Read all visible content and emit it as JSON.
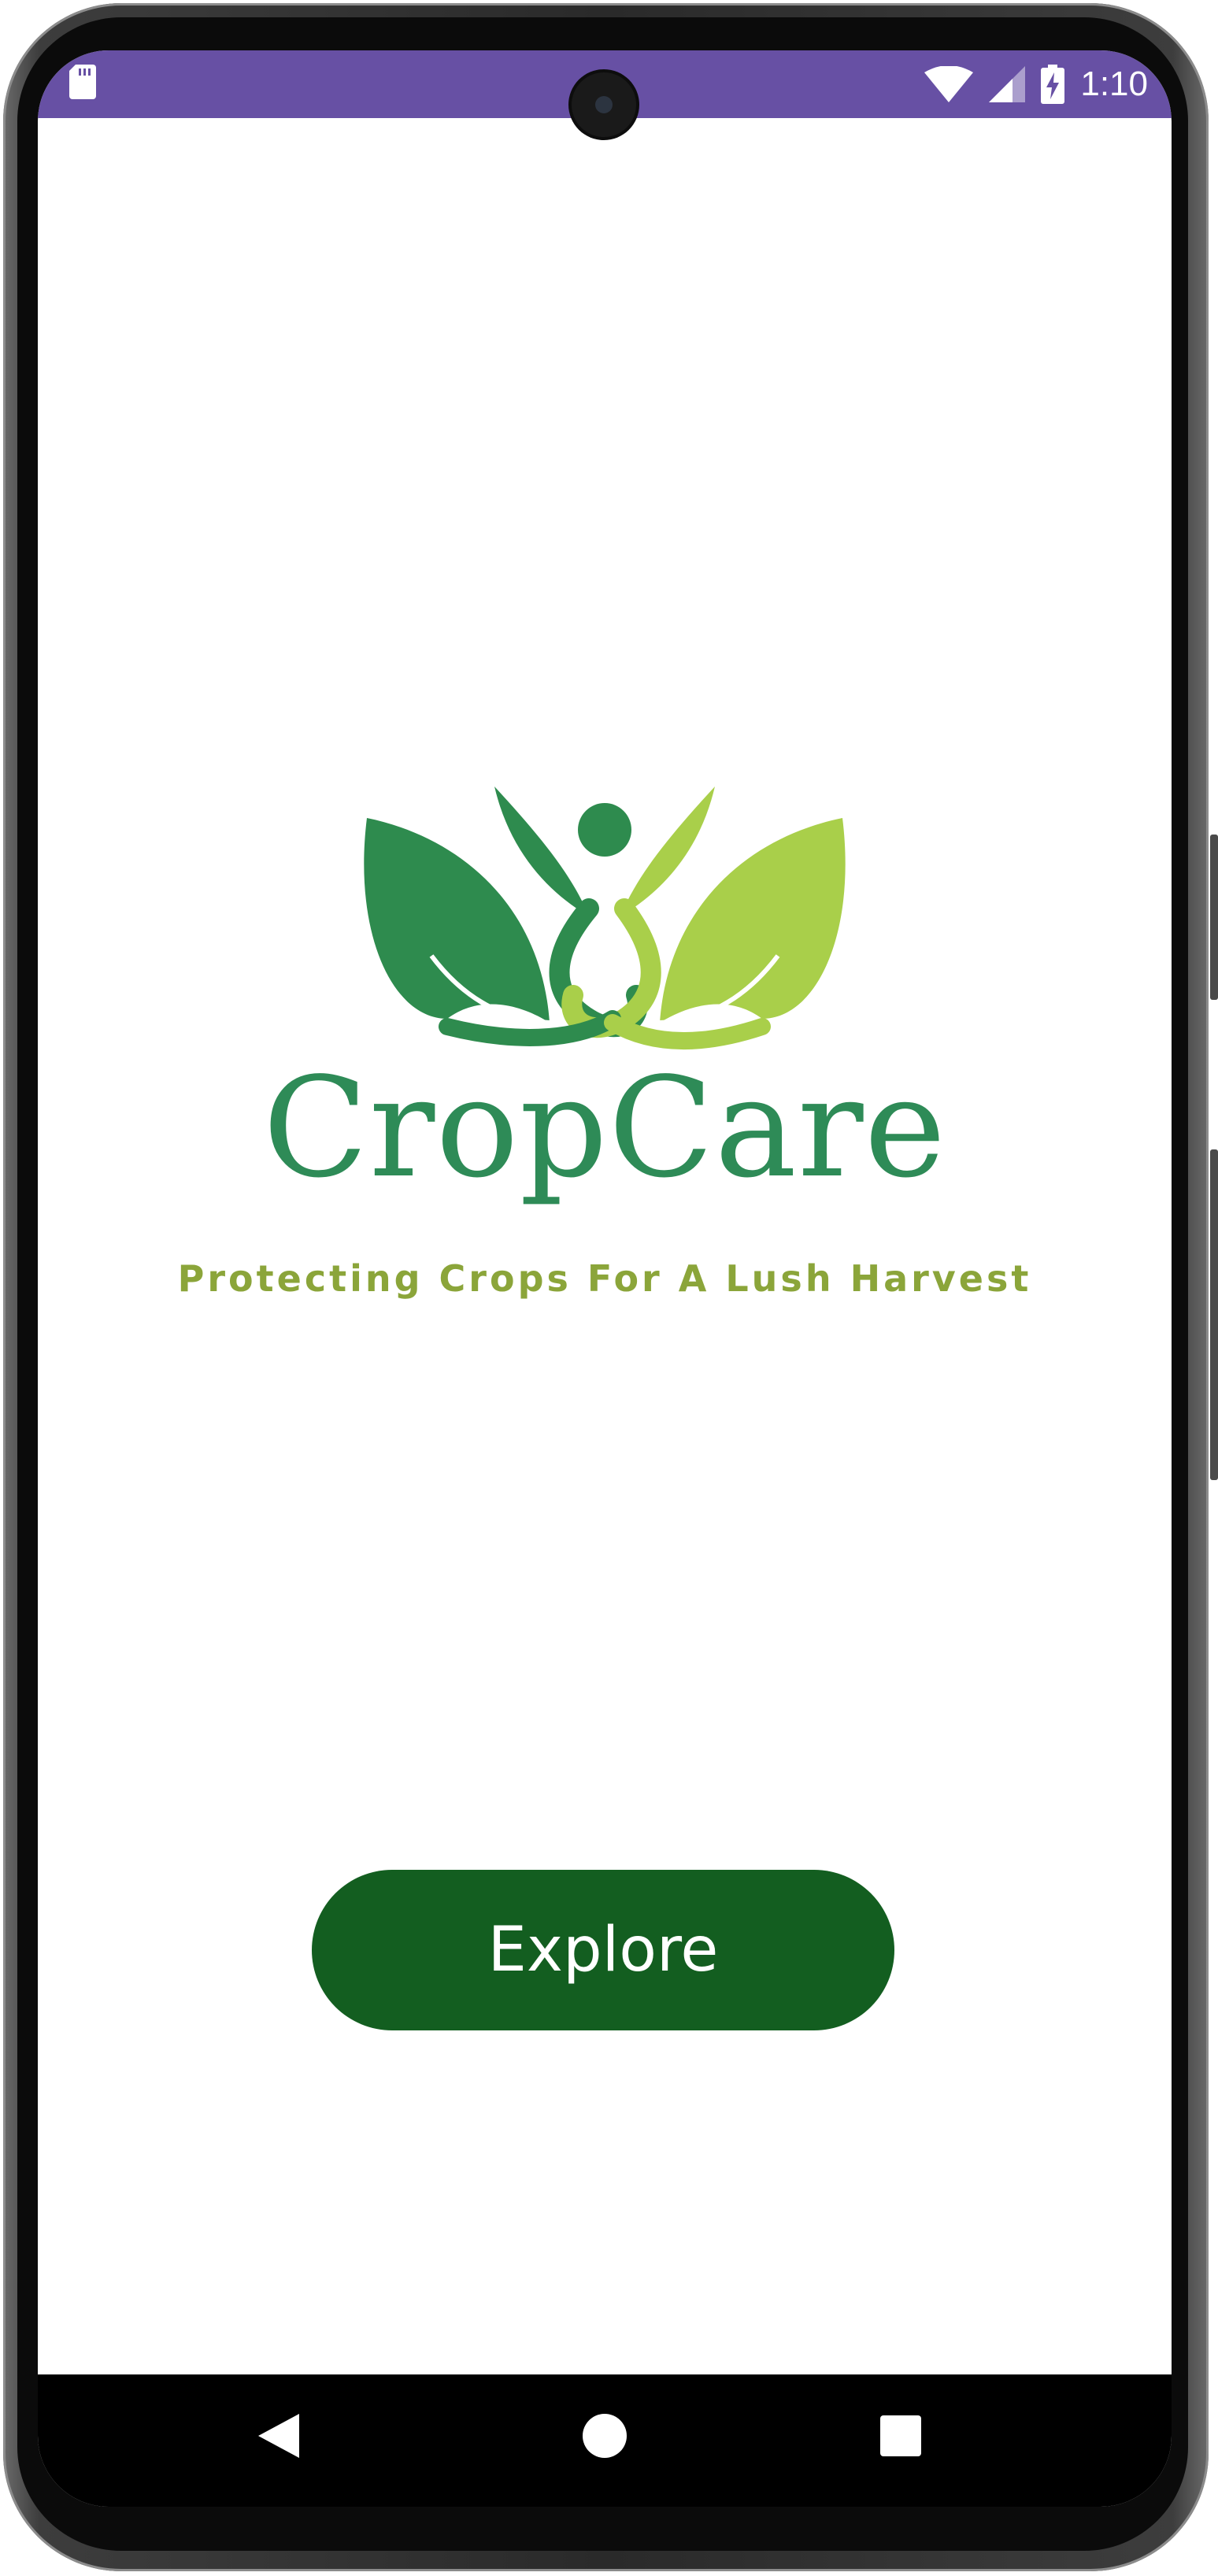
{
  "status_bar": {
    "time": "1:10",
    "icons": [
      "sd-card-icon",
      "wifi-icon",
      "cell-signal-icon",
      "battery-charging-icon"
    ],
    "background_color": "#6750a4"
  },
  "app": {
    "name": "CropCare",
    "tagline": "Protecting Crops For A Lush Harvest",
    "brand_color": "#2e8b57",
    "tagline_color": "#8ba53a"
  },
  "explore_button": {
    "label": "Explore",
    "color": "#135e20"
  },
  "nav_bar": {
    "buttons": [
      "back-icon",
      "home-icon",
      "recents-icon"
    ]
  }
}
